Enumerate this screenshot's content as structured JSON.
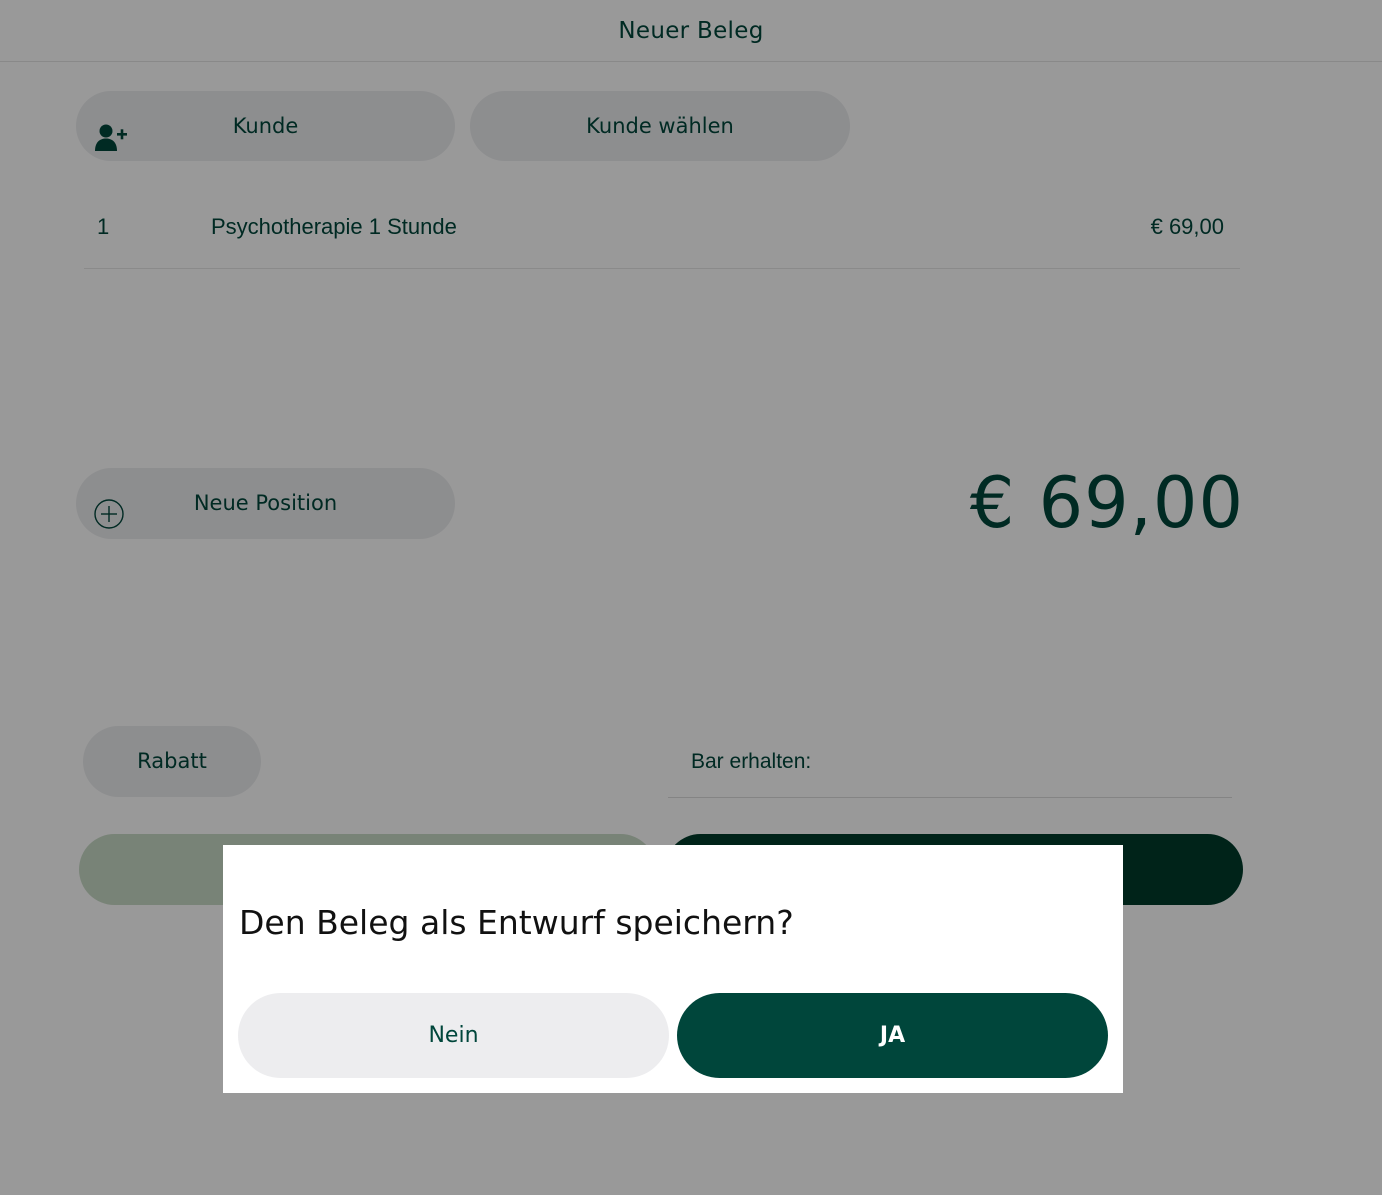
{
  "header": {
    "title": "Neuer Beleg"
  },
  "customer": {
    "add_label": "Kunde",
    "choose_label": "Kunde wählen"
  },
  "positions": [
    {
      "qty": "1",
      "description": "Psychotherapie 1 Stunde",
      "price": "€ 69,00"
    }
  ],
  "actions": {
    "new_position_label": "Neue Position",
    "discount_label": "Rabatt"
  },
  "total": "€ 69,00",
  "cash": {
    "label": "Bar erhalten:"
  },
  "dialog": {
    "title": "Den Beleg als Entwurf speichern?",
    "no_label": "Nein",
    "yes_label": "JA"
  },
  "icons": {
    "add_customer": "add-user-icon",
    "new_position": "plus-circle-icon"
  },
  "colors": {
    "brand": "#00463b",
    "overlay": "rgba(0,0,0,0.4)"
  }
}
